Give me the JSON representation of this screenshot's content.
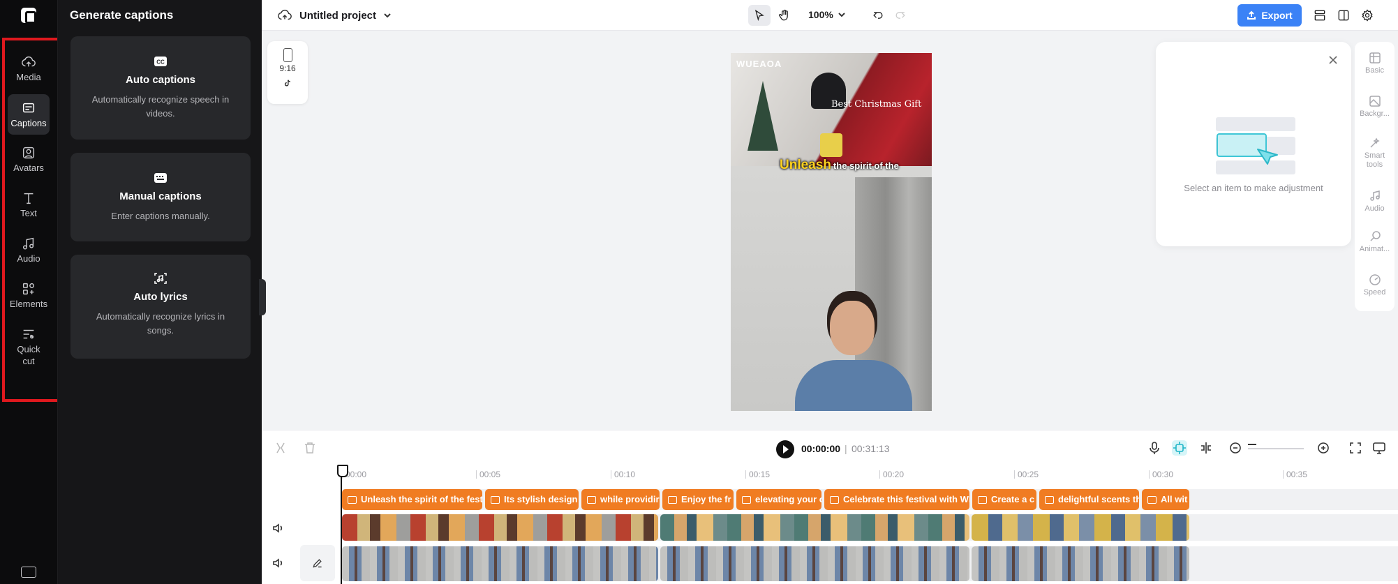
{
  "rail": {
    "items": [
      {
        "label": "Media"
      },
      {
        "label": "Captions"
      },
      {
        "label": "Avatars"
      },
      {
        "label": "Text"
      },
      {
        "label": "Audio"
      },
      {
        "label": "Elements"
      },
      {
        "label": "Quick cut"
      }
    ],
    "active": "Captions"
  },
  "panel": {
    "title": "Generate captions",
    "cards": [
      {
        "title": "Auto captions",
        "desc": "Automatically recognize speech in videos."
      },
      {
        "title": "Manual captions",
        "desc": "Enter captions manually."
      },
      {
        "title": "Auto lyrics",
        "desc": "Automatically recognize lyrics in songs."
      }
    ]
  },
  "topbar": {
    "project_name": "Untitled project",
    "zoom": "100%",
    "export_label": "Export"
  },
  "canvas": {
    "ratio": "9:16",
    "video": {
      "watermark": "WUEAOA",
      "gift_label": "Best Christmas Gift",
      "caption_highlight": "Unleash",
      "caption_rest": "the spirit of the"
    }
  },
  "props": {
    "empty_text": "Select an item to make adjustment"
  },
  "right_rail": {
    "items": [
      {
        "label": "Basic",
        "icon": "basic-icon"
      },
      {
        "label": "Backgr...",
        "icon": "background-icon"
      },
      {
        "label": "Smart tools",
        "icon": "smart-tools-icon"
      },
      {
        "label": "Audio",
        "icon": "audio-icon"
      },
      {
        "label": "Animat...",
        "icon": "animation-icon"
      },
      {
        "label": "Speed",
        "icon": "speed-icon"
      }
    ]
  },
  "playback": {
    "current_time": "00:00:00",
    "separator": "|",
    "total_time": "00:31:13"
  },
  "timeline": {
    "ruler": [
      "00:00",
      "00:05",
      "00:10",
      "00:15",
      "00:20",
      "00:25",
      "00:30",
      "00:35"
    ],
    "captions": [
      "Unleash the spirit of the festi",
      "Its stylish design",
      "while providir",
      "Enjoy the fr",
      "elevating your c",
      "Celebrate this festival with WL",
      "Create a c",
      "delightful scents th",
      "All wit"
    ]
  },
  "colors": {
    "accent": "#3b82f6",
    "caption_clip": "#f07c22",
    "highlight_frame": "#e0191e",
    "caption_highlight": "#ffd21f"
  }
}
